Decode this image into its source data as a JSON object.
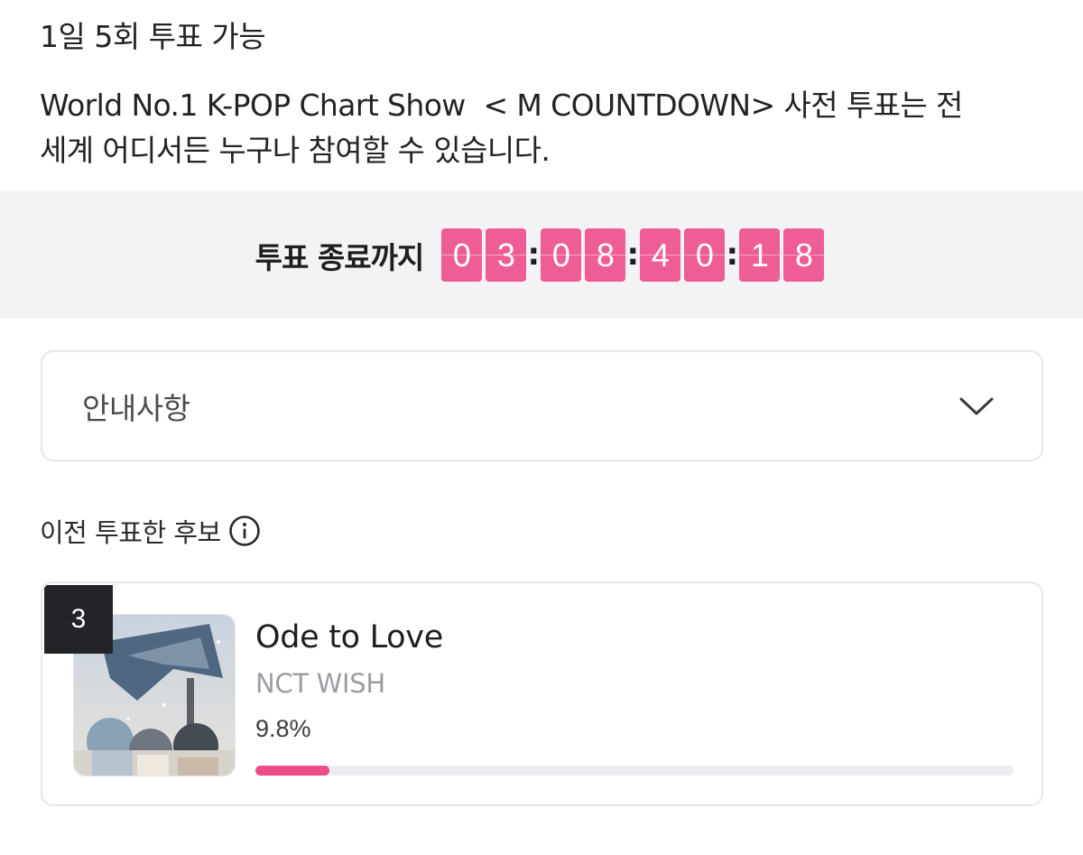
{
  "header": {
    "vote_limit": "1일 5회 투표 가능",
    "intro_line1": "World No.1 K-POP Chart Show  < M COUNTDOWN> 사전 투표는 전",
    "intro_line2": "세계 어디서든 누구나 참여할 수 있습니다."
  },
  "timer": {
    "label": "투표 종료까지",
    "digits": [
      "0",
      "3",
      "0",
      "8",
      "4",
      "0",
      "1",
      "8"
    ],
    "separator": ":",
    "digit_color": "#ee5d95"
  },
  "notice": {
    "title": "안내사항",
    "icon": "chevron-down-icon"
  },
  "previous": {
    "label": "이전 투표한 후보",
    "icon": "info-icon"
  },
  "candidate": {
    "rank": "3",
    "title": "Ode to Love",
    "artist": "NCT WISH",
    "percent_text": "9.8%",
    "progress": 0.098,
    "accent": "#ec4c88"
  }
}
